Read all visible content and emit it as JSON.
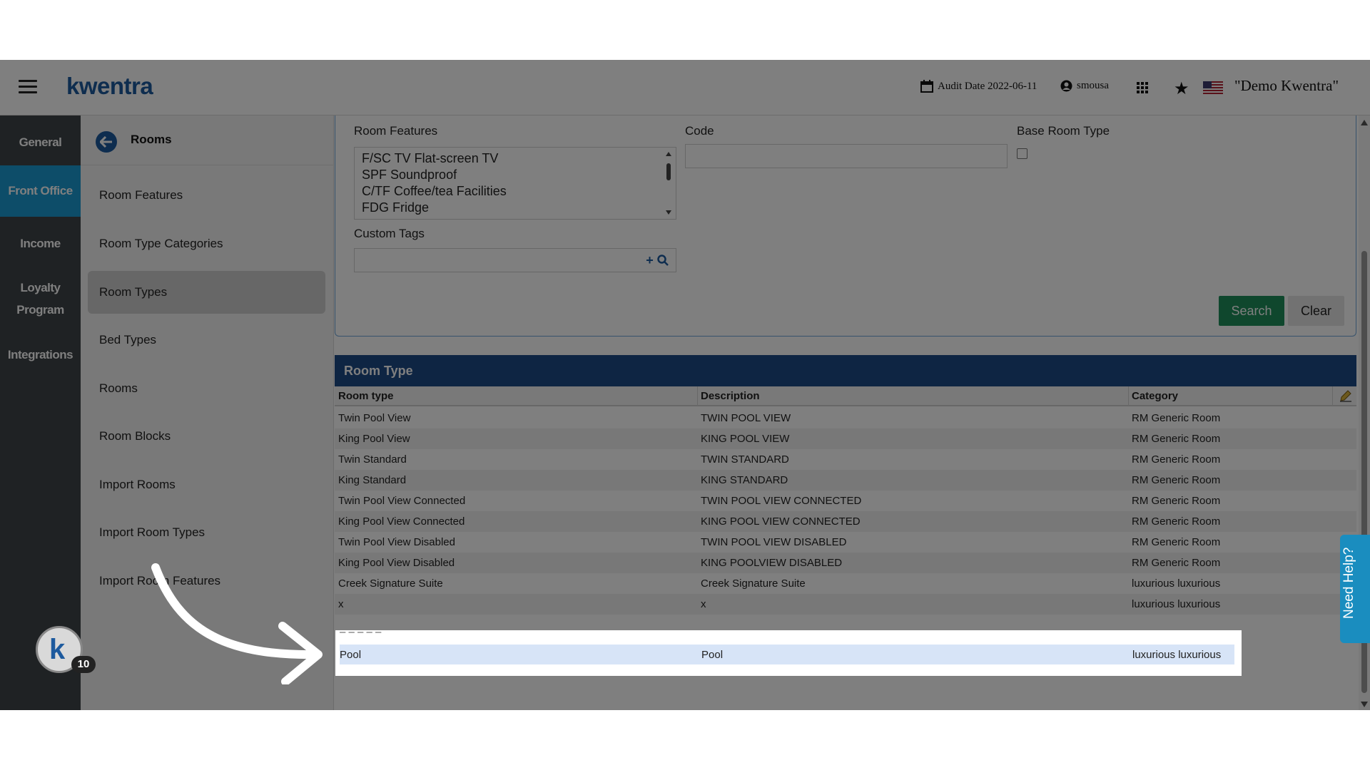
{
  "topbar": {
    "logo": "kwentra",
    "audit_date": "Audit Date 2022-06-11",
    "user": "smousa",
    "org": "\"Demo Kwentra\""
  },
  "leftnav": [
    {
      "label": "General",
      "active": false
    },
    {
      "label": "Front Office",
      "active": true
    },
    {
      "label": "Income",
      "active": false
    },
    {
      "label": "Loyalty Program",
      "active": false
    },
    {
      "label": "Integrations",
      "active": false
    }
  ],
  "sidebar": {
    "title": "Rooms",
    "items": [
      "Room Features",
      "Room Type Categories",
      "Room Types",
      "Bed Types",
      "Rooms",
      "Room Blocks",
      "Import Rooms",
      "Import Room Types",
      "Import Room Features"
    ],
    "active_item": "Room Types"
  },
  "search": {
    "room_features_label": "Room Features",
    "room_features_options": [
      "F/SC TV Flat-screen TV",
      "SPF Soundproof",
      "C/TF Coffee/tea Facilities",
      "FDG Fridge"
    ],
    "code_label": "Code",
    "code_value": "",
    "base_room_type_label": "Base Room Type",
    "custom_tags_label": "Custom Tags",
    "custom_tags_value": "",
    "search_button": "Search",
    "clear_button": "Clear"
  },
  "grid": {
    "title": "Room Type",
    "headers": [
      "Room type",
      "Description",
      "Category"
    ],
    "rows": [
      [
        "Twin Pool View",
        "TWIN POOL VIEW",
        "RM Generic Room"
      ],
      [
        "King Pool View",
        "KING POOL VIEW",
        "RM Generic Room"
      ],
      [
        "Twin Standard",
        "TWIN STANDARD",
        "RM Generic Room"
      ],
      [
        "King Standard",
        "KING STANDARD",
        "RM Generic Room"
      ],
      [
        "Twin Pool View Connected",
        "TWIN POOL VIEW CONNECTED",
        "RM Generic Room"
      ],
      [
        "King Pool View Connected",
        "KING POOL VIEW CONNECTED",
        "RM Generic Room"
      ],
      [
        "Twin Pool View Disabled",
        "TWIN POOL VIEW DISABLED",
        "RM Generic Room"
      ],
      [
        "King Pool View Disabled",
        "KING POOLVIEW DISABLED",
        "RM Generic Room"
      ],
      [
        "Creek Signature Suite",
        "Creek Signature Suite",
        "luxurious luxurious"
      ],
      [
        "x",
        "x",
        "luxurious luxurious"
      ]
    ],
    "highlighted_row": [
      "Pool",
      "Pool",
      "luxurious luxurious"
    ]
  },
  "help_tab": "Need Help?",
  "badge_count": "10",
  "colors": {
    "brand": "#1d5a9e",
    "active_nav": "#1a9bd3",
    "grid_header": "#1c4b87",
    "search_button": "#1e8f5a"
  }
}
